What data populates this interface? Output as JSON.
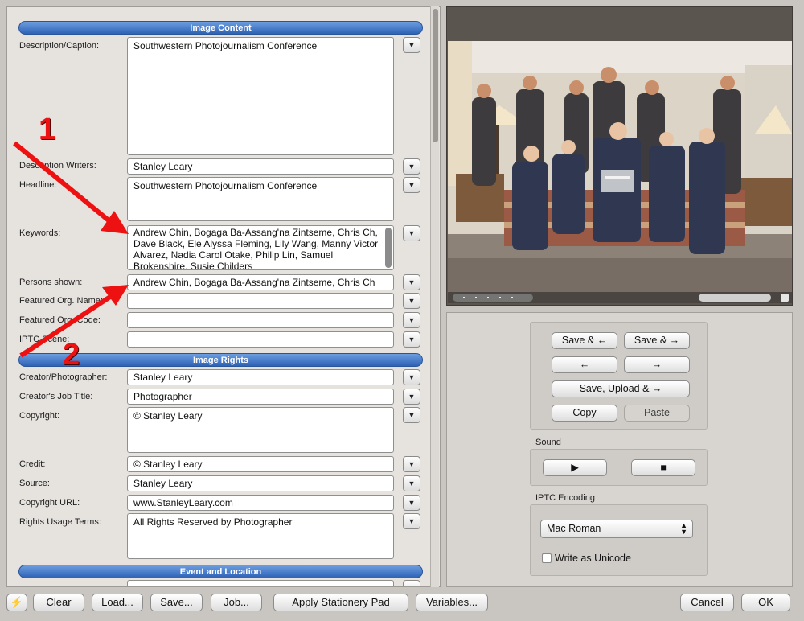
{
  "sections": {
    "image_content": "Image Content",
    "image_rights": "Image Rights",
    "event_location": "Event and Location"
  },
  "fields": {
    "description": {
      "label": "Description/Caption:",
      "value": "Southwestern Photojournalism Conference"
    },
    "writers": {
      "label": "Description Writers:",
      "value": "Stanley Leary"
    },
    "headline": {
      "label": "Headline:",
      "value": "Southwestern Photojournalism Conference"
    },
    "keywords": {
      "label": "Keywords:",
      "value": "Andrew Chin, Bogaga Ba-Assang'na Zintseme, Chris Ch, Dave Black, Ele Alyssa Fleming, Lily Wang, Manny Victor Alvarez, Nadia Carol Otake, Philip Lin, Samuel Brokenshire, Susie Childers"
    },
    "persons": {
      "label": "Persons shown:",
      "value": "Andrew Chin, Bogaga Ba-Assang'na Zintseme, Chris Ch"
    },
    "featured_org_name": {
      "label": "Featured Org. Name:",
      "value": ""
    },
    "featured_org_code": {
      "label": "Featured Org. Code:",
      "value": ""
    },
    "iptc_scene": {
      "label": "IPTC Scene:",
      "value": ""
    },
    "creator": {
      "label": "Creator/Photographer:",
      "value": "Stanley Leary"
    },
    "job_title": {
      "label": "Creator's Job Title:",
      "value": "Photographer"
    },
    "copyright": {
      "label": "Copyright:",
      "value": "© Stanley Leary"
    },
    "credit": {
      "label": "Credit:",
      "value": "© Stanley Leary"
    },
    "source": {
      "label": "Source:",
      "value": "Stanley Leary"
    },
    "copyright_url": {
      "label": "Copyright URL:",
      "value": "www.StanleyLeary.com"
    },
    "rights_terms": {
      "label": "Rights Usage Terms:",
      "value": "All Rights Reserved by Photographer"
    }
  },
  "annotations": {
    "one": "1",
    "two": "2"
  },
  "nav_buttons": {
    "save_prev": "Save & ←",
    "save_next": "Save & →",
    "prev": "←",
    "next": "→",
    "save_upload_next": "Save, Upload & →",
    "copy": "Copy",
    "paste": "Paste"
  },
  "sound": {
    "label": "Sound",
    "play": "▶",
    "stop": "■"
  },
  "iptc_encoding": {
    "label": "IPTC Encoding",
    "selected": "Mac Roman",
    "unicode_label": "Write as Unicode"
  },
  "bottom": {
    "lightning": "⚡",
    "clear": "Clear",
    "load": "Load...",
    "save": "Save...",
    "job": "Job...",
    "stationery": "Apply Stationery Pad",
    "variables": "Variables...",
    "cancel": "Cancel",
    "ok": "OK"
  },
  "colors": {
    "section_bar": "#2e63b6",
    "annotation_red": "#ee1111"
  }
}
